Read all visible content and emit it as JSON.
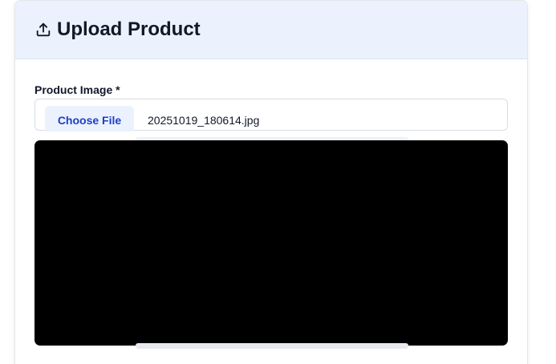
{
  "header": {
    "icon": "upload-icon",
    "title": "Upload Product"
  },
  "form": {
    "image_field": {
      "label": "Product Image *",
      "button_label": "Choose File",
      "file_name": "20251019_180614.jpg"
    }
  },
  "colors": {
    "header_background": "#ebf2fe",
    "accent": "#1d3fc4",
    "preview_background": "#000000"
  }
}
